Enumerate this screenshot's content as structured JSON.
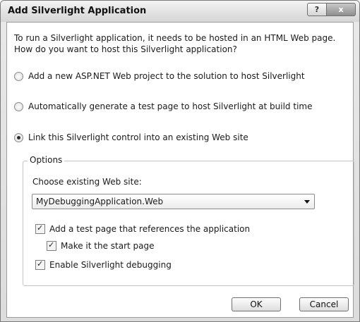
{
  "window": {
    "title": "Add Silverlight Application",
    "help_glyph": "?",
    "close_glyph": "x"
  },
  "intro_text": "To run a Silverlight application, it needs to be hosted in an HTML Web page. How do you want to host this Silverlight application?",
  "host_options": [
    {
      "label": "Add a new ASP.NET Web project to the solution to host Silverlight",
      "selected": false
    },
    {
      "label": "Automatically generate a test page to host Silverlight at build time",
      "selected": false
    },
    {
      "label": "Link this Silverlight control into an existing Web site",
      "selected": true
    }
  ],
  "options_group": {
    "legend": "Options",
    "site_label": "Choose existing Web site:",
    "site_value": "MyDebuggingApplication.Web",
    "checkboxes": [
      {
        "label": "Add a test page that references the application",
        "checked": true
      },
      {
        "label": "Make it the start page",
        "checked": true
      },
      {
        "label": "Enable Silverlight debugging",
        "checked": true
      }
    ]
  },
  "buttons": {
    "ok": "OK",
    "cancel": "Cancel"
  }
}
